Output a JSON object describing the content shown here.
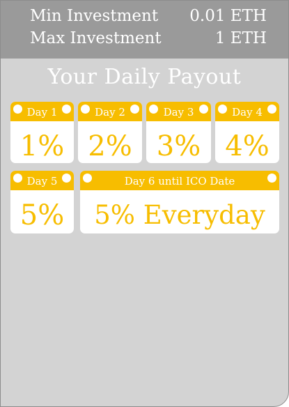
{
  "investment": {
    "min_label": "Min Investment",
    "min_value": "0.01 ETH",
    "max_label": "Max Investment",
    "max_value": "1 ETH"
  },
  "payout": {
    "title": "Your Daily Payout",
    "cards": [
      {
        "label": "Day 1",
        "value": "1%"
      },
      {
        "label": "Day 2",
        "value": "2%"
      },
      {
        "label": "Day 3",
        "value": "3%"
      },
      {
        "label": "Day 4",
        "value": "4%"
      },
      {
        "label": "Day 5",
        "value": "5%"
      },
      {
        "label": "Day 6 until ICO Date",
        "value": "5% Everyday"
      }
    ]
  },
  "colors": {
    "accent": "#f7bd00",
    "header_bg": "#9a9a9a",
    "panel_bg": "#d3d3d3"
  }
}
